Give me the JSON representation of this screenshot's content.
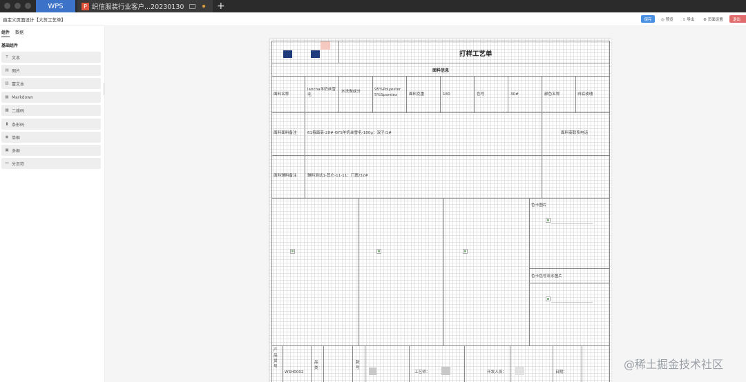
{
  "titlebar": {
    "wps_tab": "WPS",
    "doc_tab": "织信服装行业客户...20230130",
    "doc_icon": "P",
    "add_tab": "+"
  },
  "toolbar": {
    "title": "自定义页面设计【大货工艺单】",
    "save": "保存",
    "preview": "预览",
    "export": "导出",
    "page_settings": "页面设置",
    "exit": "退出"
  },
  "sidebar": {
    "tabs": [
      "组件",
      "数据"
    ],
    "section": "基础组件",
    "items": [
      {
        "icon": "T",
        "label": "文本"
      },
      {
        "icon": "▤",
        "label": "图片"
      },
      {
        "icon": "▥",
        "label": "富文本"
      },
      {
        "icon": "▦",
        "label": "Markdown"
      },
      {
        "icon": "▩",
        "label": "二维码"
      },
      {
        "icon": "▮",
        "label": "条形码"
      },
      {
        "icon": "◉",
        "label": "单框"
      },
      {
        "icon": "▣",
        "label": "多框"
      },
      {
        "icon": "▭",
        "label": "分页符"
      }
    ]
  },
  "sheet": {
    "title": "打样工艺单",
    "section_fabric": "面料信息",
    "row1": {
      "fabric_name_label": "面料名称",
      "fabric_name_value": "lancha羊奶丝雪毛",
      "wash_label": "水洗做成分",
      "composition": "95%Polyester 5%Spandex",
      "weight_label": "面料克重",
      "weight_value": "180",
      "color_no_label": "色号",
      "color_no_value": "30#",
      "color_name_label": "颜色名称",
      "color_name_value": "白底玫瑰"
    },
    "row2": {
      "label": "面料面料备注",
      "value": "61俄面商-28#-GYS羊奶丝雪毛-180g：双子/1#",
      "supplier_label": "面料商联系电话"
    },
    "row3": {
      "label": "面料辅料备注",
      "value": "辅料测试1-其它-11-11：门匮/32#"
    },
    "color_card_label": "色卡图片",
    "color_card_detail_label": "色卡色号流水图片",
    "bottom": {
      "product_label": "产品货号",
      "product_value": "WSH0002",
      "category_label": "品类",
      "season_label": "款号",
      "craftsman_label": "工艺师：",
      "developer_label": "开发人员：",
      "date_label": "日期："
    }
  },
  "watermark": "@稀土掘金技术社区"
}
